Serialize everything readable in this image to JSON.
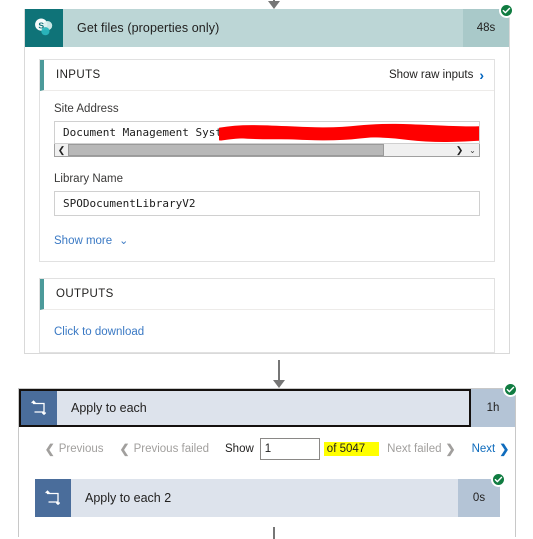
{
  "connectors": {
    "top_arrow": "arrow-down",
    "middle_arrow": "arrow-down",
    "bottom_stem": "line-down"
  },
  "get_files_action": {
    "icon": "sharepoint-icon",
    "title": "Get files (properties only)",
    "duration": "48s",
    "status": "succeeded",
    "status_icon": "check-circle-icon",
    "inputs_panel": {
      "label": "INPUTS",
      "raw_link": "Show raw inputs",
      "raw_link_icon": "chevron-right-icon",
      "fields": [
        {
          "label": "Site Address",
          "value": "Document Management System - ",
          "redacted": true,
          "scrollbar": {
            "left_icon": "chevron-left-icon",
            "right_icon": "chevron-right-icon",
            "corner_icon": "chevron-down-icon"
          }
        },
        {
          "label": "Library Name",
          "value": "SPODocumentLibraryV2",
          "redacted": false
        }
      ],
      "show_more": "Show more",
      "show_more_icon": "chevron-down-icon"
    },
    "outputs_panel": {
      "label": "OUTPUTS",
      "download_link": "Click to download"
    }
  },
  "apply_to_each": {
    "icon": "foreach-loop-icon",
    "title": "Apply to each",
    "duration": "1h",
    "status": "succeeded",
    "status_icon": "check-circle-icon",
    "pager": {
      "previous": "Previous",
      "previous_icon": "chevron-left-icon",
      "previous_failed": "Previous failed",
      "previous_failed_icon": "chevron-left-icon",
      "show_label": "Show",
      "page_value": "1",
      "page_placeholder": "1",
      "total_label": "of 5047",
      "total_count": "5047",
      "next_failed": "Next failed",
      "next_failed_icon": "chevron-right-icon",
      "next": "Next",
      "next_icon": "chevron-right-icon"
    },
    "nested_action": {
      "icon": "foreach-loop-icon",
      "title": "Apply to each 2",
      "duration": "0s",
      "status": "succeeded",
      "status_icon": "check-circle-icon"
    }
  },
  "colors": {
    "sharepoint_tile": "#0f7378",
    "sharepoint_header": "#bcd6d6",
    "loop_tile": "#4a6d9b",
    "loop_header": "#dde3ec",
    "panel_accent": "#4c9a9a",
    "link_blue": "#3a79c4",
    "success_green": "#107c41",
    "highlight_yellow": "#ffff00",
    "redaction_red": "#ff0000"
  }
}
